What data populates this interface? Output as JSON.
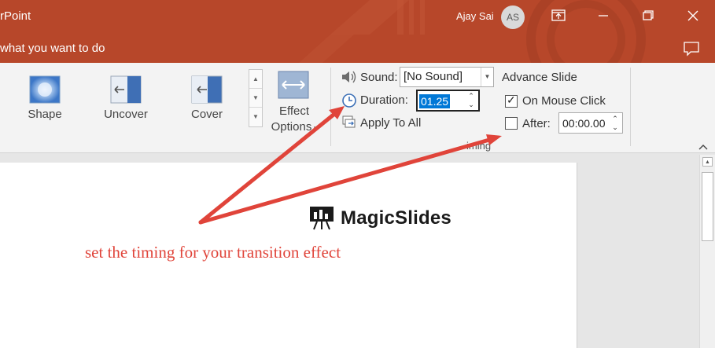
{
  "window": {
    "app_title": "rPoint",
    "user_name": "Ajay Sai",
    "user_initials": "AS"
  },
  "tell_me": {
    "text": "what you want to do"
  },
  "gallery": {
    "items": [
      {
        "label": "Shape",
        "icon": "shape-transition-icon"
      },
      {
        "label": "Uncover",
        "icon": "uncover-transition-icon"
      },
      {
        "label": "Cover",
        "icon": "cover-transition-icon"
      }
    ]
  },
  "effect_options": {
    "label_line1": "Effect",
    "label_line2": "Options"
  },
  "timing": {
    "sound_label": "Sound:",
    "sound_value": "[No Sound]",
    "duration_label": "Duration:",
    "duration_value": "01.25",
    "apply_all_label": "Apply To All",
    "advance_title": "Advance Slide",
    "on_mouse_click_label": "On Mouse Click",
    "on_mouse_click_checked": true,
    "after_label": "After:",
    "after_checked": false,
    "after_value": "00:00.00",
    "group_label": "iming"
  },
  "slide": {
    "logo_text": "MagicSlides",
    "caption": "set the timing for your transition effect"
  },
  "colors": {
    "ribbon_accent": "#b7472a",
    "annotation": "#e0443a",
    "selection": "#0078d7"
  }
}
